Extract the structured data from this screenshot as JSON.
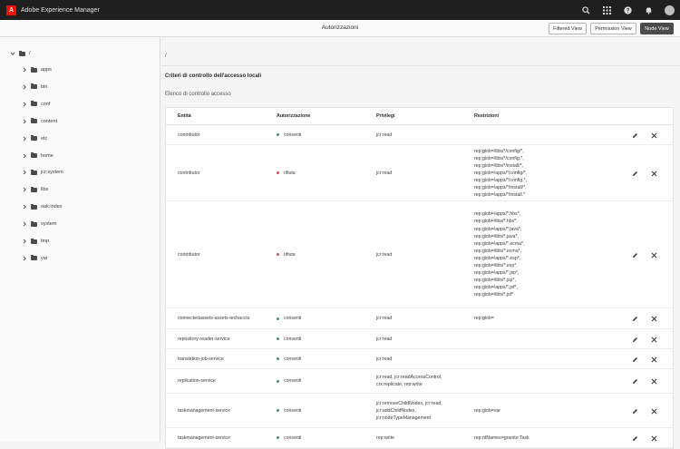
{
  "app": {
    "title": "Adobe Experience Manager",
    "logo_letter": "A"
  },
  "topbar": {
    "icons": [
      "search-icon",
      "apps-grid-icon",
      "help-icon",
      "bell-icon",
      "user-avatar"
    ]
  },
  "header": {
    "title": "Autorizzazioni",
    "buttons": [
      {
        "label": "Filtered View",
        "active": false
      },
      {
        "label": "Permission View",
        "active": false
      },
      {
        "label": "Node View",
        "active": true
      }
    ]
  },
  "tree": {
    "root": "/",
    "items": [
      "apps",
      "bin",
      "conf",
      "content",
      "etc",
      "home",
      "jcr:system",
      "libs",
      "oak:index",
      "system",
      "tmp",
      "var"
    ]
  },
  "main": {
    "path": "/",
    "section_title": "Criteri di controllo dell'accesso locali",
    "subtitle": "Elenco di controllo accesso",
    "columns": [
      "Entità",
      "Autorizzazione",
      "Privilegi",
      "Restrizioni"
    ],
    "colors": {
      "allow": "#2d9d78",
      "deny": "#e34850"
    },
    "rows": [
      {
        "entity": "contributor",
        "permission": "consenti",
        "type": "allow",
        "privileges": [
          "jcr:read"
        ],
        "restrictions": []
      },
      {
        "entity": "contributor",
        "permission": "rifiuta",
        "type": "deny",
        "privileges": [
          "jcr:read"
        ],
        "restrictions": [
          "rep:glob=/libs/*/config/*,",
          "rep:glob=/libs/*/config.*,",
          "rep:glob=/libs/*/install/*,",
          "rep:glob=/apps/*/config/*,",
          "rep:glob=/apps/*/config.*,",
          "rep:glob=/apps/*/install/*,",
          "rep:glob=/apps/*/install.*"
        ]
      },
      {
        "entity": "contributor",
        "permission": "rifiuta",
        "type": "deny",
        "privileges": [
          "jcr:read"
        ],
        "restrictions": [
          "rep:glob=/apps/*.hbs*,",
          "rep:glob=/libs/*.hbs*,",
          "rep:glob=/apps/*.java*,",
          "rep:glob=/libs/*.java*,",
          "rep:glob=/apps/*.ecma*,",
          "rep:glob=/libs/*.ecma*,",
          "rep:glob=/apps/*.esp*,",
          "rep:glob=/libs/*.esp*,",
          "rep:glob=/apps/*.jsp*,",
          "rep:glob=/libs/*.jsp*,",
          "rep:glob=/apps/*.jsf*,",
          "rep:glob=/libs/*.jsf*"
        ]
      },
      {
        "entity": "connectedassets-assets-techaccts",
        "permission": "consenti",
        "type": "allow",
        "privileges": [
          "jcr:read"
        ],
        "restrictions": [
          "rep:glob="
        ]
      },
      {
        "entity": "repository-reader-service",
        "permission": "consenti",
        "type": "allow",
        "privileges": [
          "jcr:read"
        ],
        "restrictions": []
      },
      {
        "entity": "translation-job-service",
        "permission": "consenti",
        "type": "allow",
        "privileges": [
          "jcr:read"
        ],
        "restrictions": []
      },
      {
        "entity": "replication-service",
        "permission": "consenti",
        "type": "allow",
        "privileges": [
          "jcr:read, jcr:readAccessControl,",
          "crx:replicate, rep:write"
        ],
        "restrictions": []
      },
      {
        "entity": "taskmanagement-service",
        "permission": "consenti",
        "type": "allow",
        "privileges": [
          "jcr:removeChildNodes, jcr:read,",
          "jcr:addChildNodes,",
          "jcr:nodeTypeManagement"
        ],
        "restrictions": [
          "rep:glob=var"
        ]
      },
      {
        "entity": "taskmanagement-service",
        "permission": "consenti",
        "type": "allow",
        "privileges": [
          "rep:write"
        ],
        "restrictions": [
          "rep:ntNames=granite:Task"
        ]
      }
    ]
  }
}
